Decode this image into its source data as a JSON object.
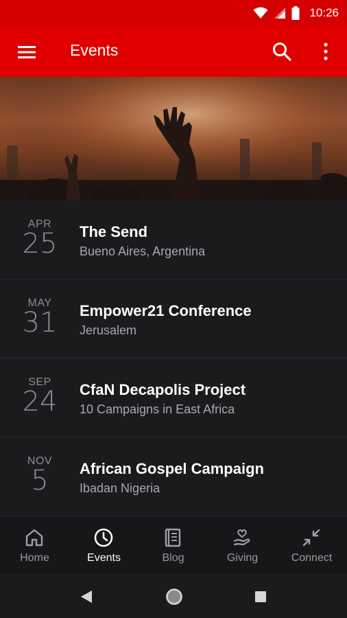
{
  "status": {
    "time": "10:26"
  },
  "appbar": {
    "title": "Events"
  },
  "events": [
    {
      "month": "APR",
      "day": "25",
      "name": "The Send",
      "location": "Bueno Aires, Argentina"
    },
    {
      "month": "MAY",
      "day": "31",
      "name": "Empower21 Conference",
      "location": "Jerusalem"
    },
    {
      "month": "SEP",
      "day": "24",
      "name": "CfaN Decapolis Project",
      "location": "10 Campaigns in East Africa"
    },
    {
      "month": "NOV",
      "day": "5",
      "name": "African Gospel Campaign",
      "location": "Ibadan Nigeria"
    }
  ],
  "nav": [
    {
      "label": "Home",
      "icon": "home-icon"
    },
    {
      "label": "Events",
      "icon": "clock-icon",
      "active": true
    },
    {
      "label": "Blog",
      "icon": "book-icon"
    },
    {
      "label": "Giving",
      "icon": "giving-hand-icon"
    },
    {
      "label": "Connect",
      "icon": "arrows-in-icon"
    }
  ],
  "colors": {
    "accent": "#e10000",
    "statusbar": "#d50000",
    "background": "#1a1b1d"
  }
}
